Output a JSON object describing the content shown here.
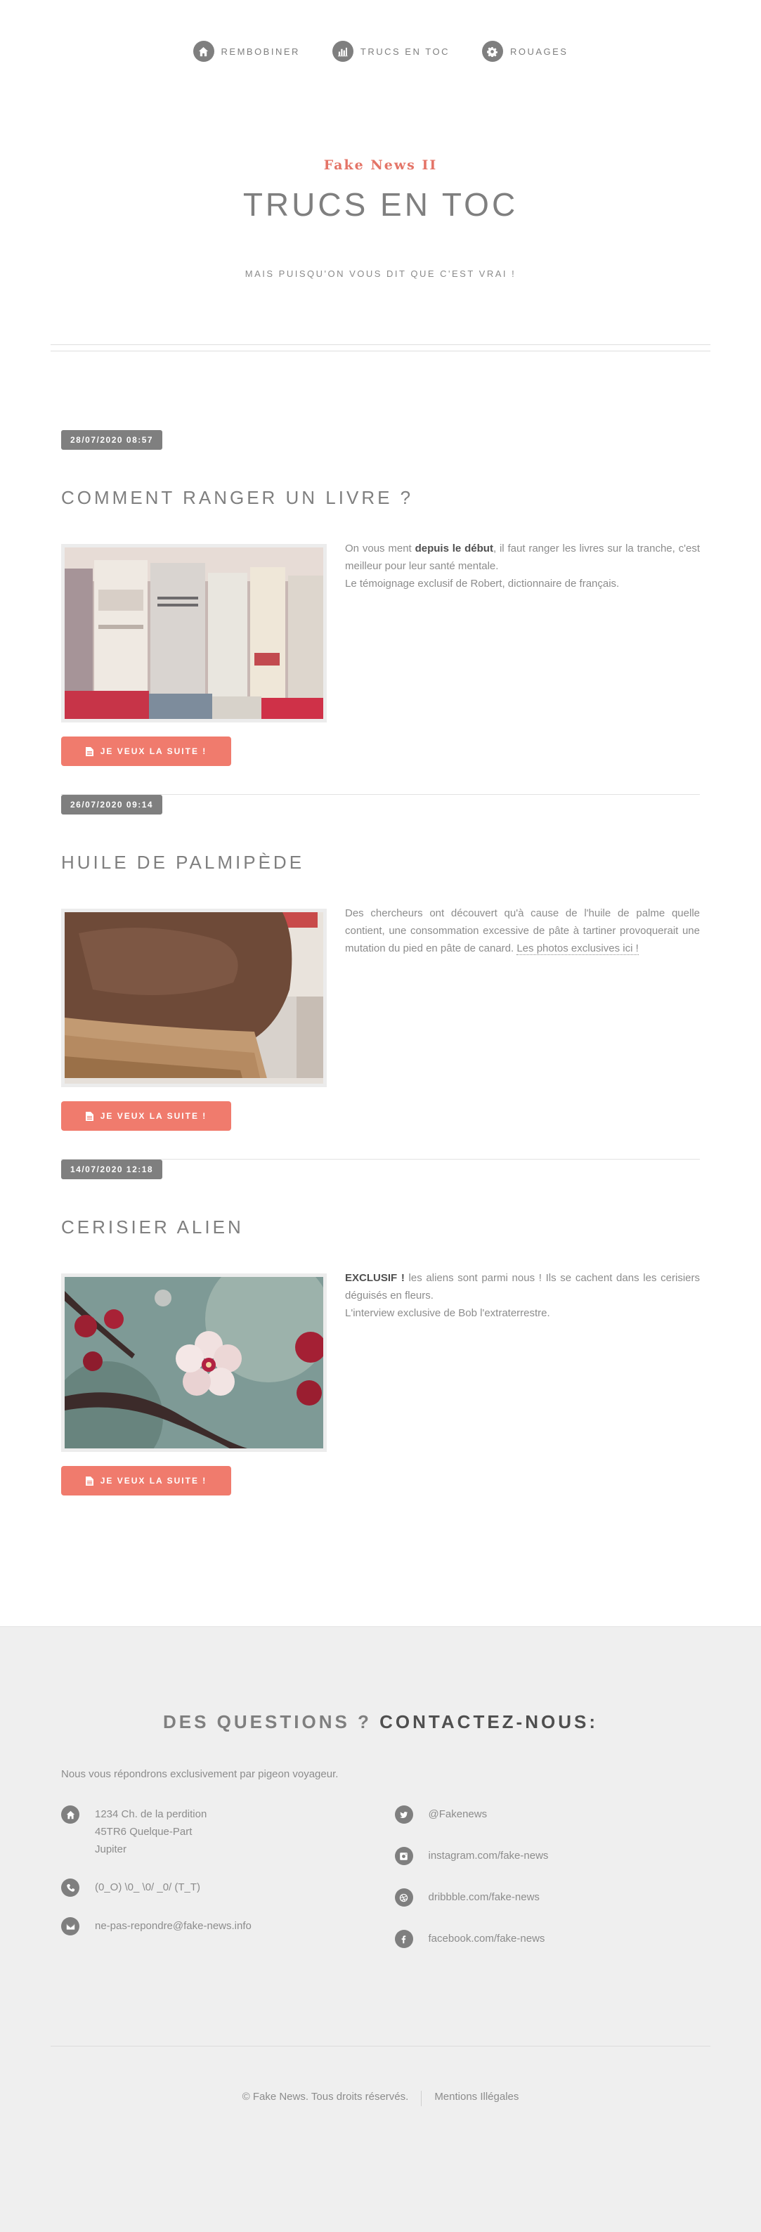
{
  "nav": {
    "items": [
      {
        "label": "Rembobiner",
        "icon": "home-icon"
      },
      {
        "label": "Trucs en toc",
        "icon": "bar-chart-icon"
      },
      {
        "label": "Rouages",
        "icon": "gear-icon"
      }
    ]
  },
  "header": {
    "subtitle": "Fake News II",
    "title": "TRUCS EN TOC",
    "tagline": "MAIS PUISQU'ON VOUS DIT QUE C'EST VRAI !"
  },
  "posts": [
    {
      "date": "28/07/2020 08:57",
      "title": "COMMENT RANGER UN LIVRE ?",
      "image": "books-photo",
      "text_1": "On vous ment ",
      "text_bold": "depuis le début",
      "text_2": ", il faut ranger les livres sur la tranche, c'est meilleur pour leur santé mentale.",
      "text_3": "Le témoignage exclusif de Robert, dictionnaire de français.",
      "cta": "JE VEUX LA SUITE !"
    },
    {
      "date": "26/07/2020 09:14",
      "title": "HUILE DE PALMIPÈDE",
      "image": "chocolate-spread-toast-photo",
      "text_1": "Des chercheurs ont découvert qu'à cause de l'huile de palme quelle contient, une consommation excessive de pâte à tartiner provoquerait une mutation du pied en pâte de canard. ",
      "text_link": "Les photos exclusives ici !",
      "cta": "JE VEUX LA SUITE !"
    },
    {
      "date": "14/07/2020 12:18",
      "title": "CERISIER ALIEN",
      "image": "cherry-blossom-photo",
      "text_bold": "EXCLUSIF !",
      "text_1": " les aliens sont parmi nous ! Ils se cachent dans les cerisiers déguisés en fleurs.",
      "text_3": "L'interview exclusive de Bob l'extraterrestre.",
      "cta": "JE VEUX LA SUITE !"
    }
  ],
  "footer": {
    "contact_title_light": "DES QUESTIONS ? ",
    "contact_title_bold": "CONTACTEZ-NOUS:",
    "intro": "Nous vous répondrons exclusivement par pigeon voyageur.",
    "address": [
      "1234 Ch. de la perdition",
      "45TR6 Quelque-Part",
      "Jupiter"
    ],
    "phone": "(0_O) \\0_ \\0/ _0/ (T_T)",
    "email": "ne-pas-repondre@fake-news.info",
    "social": [
      {
        "label": "@Fakenews",
        "icon": "twitter-icon"
      },
      {
        "label": "instagram.com/fake-news",
        "icon": "instagram-icon"
      },
      {
        "label": "dribbble.com/fake-news",
        "icon": "dribbble-icon"
      },
      {
        "label": "facebook.com/fake-news",
        "icon": "facebook-icon"
      }
    ],
    "copyright": "© Fake News. Tous droits réservés.",
    "legal": "Mentions Illégales"
  }
}
